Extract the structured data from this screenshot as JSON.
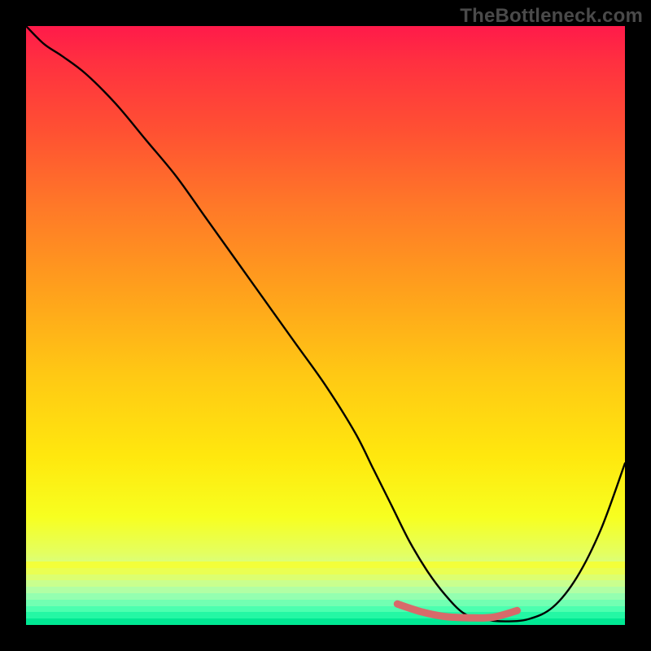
{
  "watermark": "TheBottleneck.com",
  "chart_data": {
    "type": "line",
    "title": "",
    "xlabel": "",
    "ylabel": "",
    "xlim": [
      0,
      100
    ],
    "ylim": [
      0,
      100
    ],
    "series": [
      {
        "name": "bottleneck-curve",
        "x": [
          0,
          3,
          6,
          10,
          15,
          20,
          25,
          30,
          35,
          40,
          45,
          50,
          55,
          58,
          61,
          64,
          67,
          70,
          73,
          76,
          80,
          84,
          88,
          92,
          96,
          100
        ],
        "y": [
          100,
          97,
          95,
          92,
          87,
          81,
          75,
          68,
          61,
          54,
          47,
          40,
          32,
          26,
          20,
          14,
          9,
          5,
          2,
          1,
          0.6,
          1,
          3,
          8,
          16,
          27
        ]
      }
    ],
    "marker_region": {
      "name": "sweet-spot",
      "x": [
        62,
        66,
        70,
        74,
        78,
        82
      ],
      "y": [
        3.5,
        2.2,
        1.4,
        1.2,
        1.3,
        2.4
      ]
    },
    "background": {
      "type": "vertical-gradient",
      "meaning": "red=high bottleneck, green=low bottleneck",
      "stops": [
        {
          "pos": 0,
          "color": "#ff1a4a"
        },
        {
          "pos": 50,
          "color": "#ffc814"
        },
        {
          "pos": 85,
          "color": "#f7ff20"
        },
        {
          "pos": 100,
          "color": "#00e8a0"
        }
      ]
    }
  },
  "colors": {
    "frame": "#000000",
    "curve": "#000000",
    "marker": "#d86a6a",
    "watermark": "#4a4a4a"
  }
}
